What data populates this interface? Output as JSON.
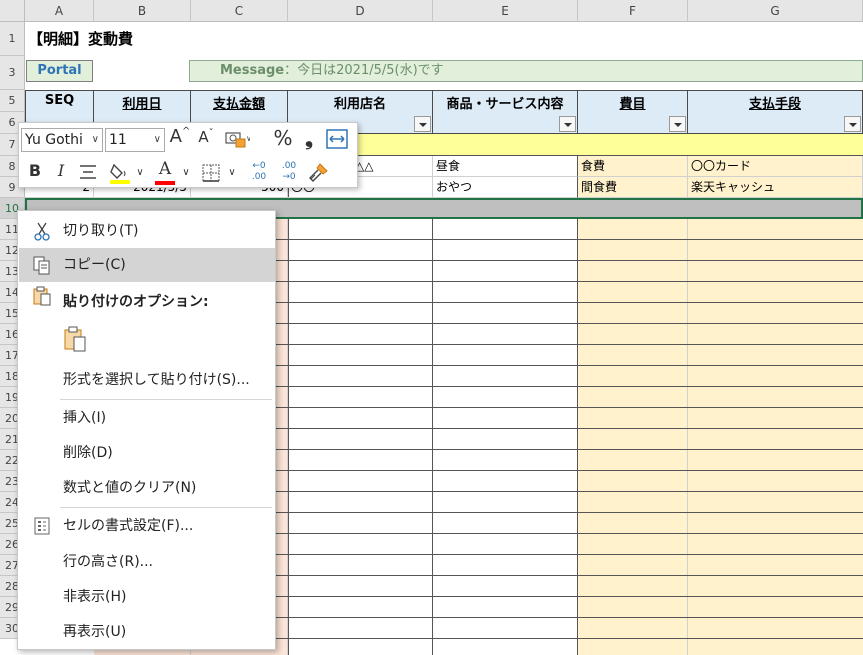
{
  "columns": [
    "A",
    "B",
    "C",
    "D",
    "E",
    "F",
    "G"
  ],
  "rows": [
    "1",
    "3",
    "5",
    "6",
    "7",
    "8",
    "9",
    "10",
    "11",
    "12",
    "13",
    "14",
    "15",
    "16",
    "17",
    "18",
    "19",
    "20",
    "21",
    "22",
    "23",
    "24",
    "25",
    "26",
    "27",
    "28",
    "29",
    "30"
  ],
  "sheet": {
    "title": "【明細】変動費",
    "portal_label": "Portal",
    "message_label": "Message",
    "message_text": "：今日は2021/5/5(水)です",
    "headers": {
      "seq": "SEQ",
      "date": "利用日",
      "amount": "支払金額",
      "store": "利用店名",
      "item": "商品・サービス内容",
      "category": "費目",
      "method": "支払手段"
    },
    "data_rows": [
      {
        "seq": "",
        "date": "",
        "amount": "",
        "store": "△△",
        "item": "昼食",
        "category": "食費",
        "method": "〇〇カード"
      },
      {
        "seq": "2",
        "date": "2021/5/5",
        "amount": "500",
        "store": "〇〇",
        "item": "おやつ",
        "category": "間食費",
        "method": "楽天キャッシュ"
      }
    ]
  },
  "mini_toolbar": {
    "font_name": "Yu Gothi",
    "font_size": "11",
    "grow_font": "A^",
    "shrink_font": "Aˇ",
    "percent": "%",
    "comma": "❟",
    "bold": "B",
    "italic": "I",
    "highlight_color": "#ffff00",
    "font_color": "#ff0000",
    "inc_decimal": ".00",
    "dec_decimal": ".00"
  },
  "context_menu": {
    "cut": "切り取り(T)",
    "copy": "コピー(C)",
    "paste_options": "貼り付けのオプション:",
    "paste_special": "形式を選択して貼り付け(S)...",
    "insert": "挿入(I)",
    "delete": "削除(D)",
    "clear": "数式と値のクリア(N)",
    "format_cells": "セルの書式設定(F)...",
    "row_height": "行の高さ(R)...",
    "hide": "非表示(H)",
    "unhide": "再表示(U)"
  },
  "colors": {
    "header_fill": "#ddebf7",
    "pink_fill": "#fce4d6",
    "yellow_fill": "#fff2cc",
    "message_fill": "#e2efda",
    "selection_row": "#bfbfbf",
    "band_yellow": "#ffff99"
  }
}
